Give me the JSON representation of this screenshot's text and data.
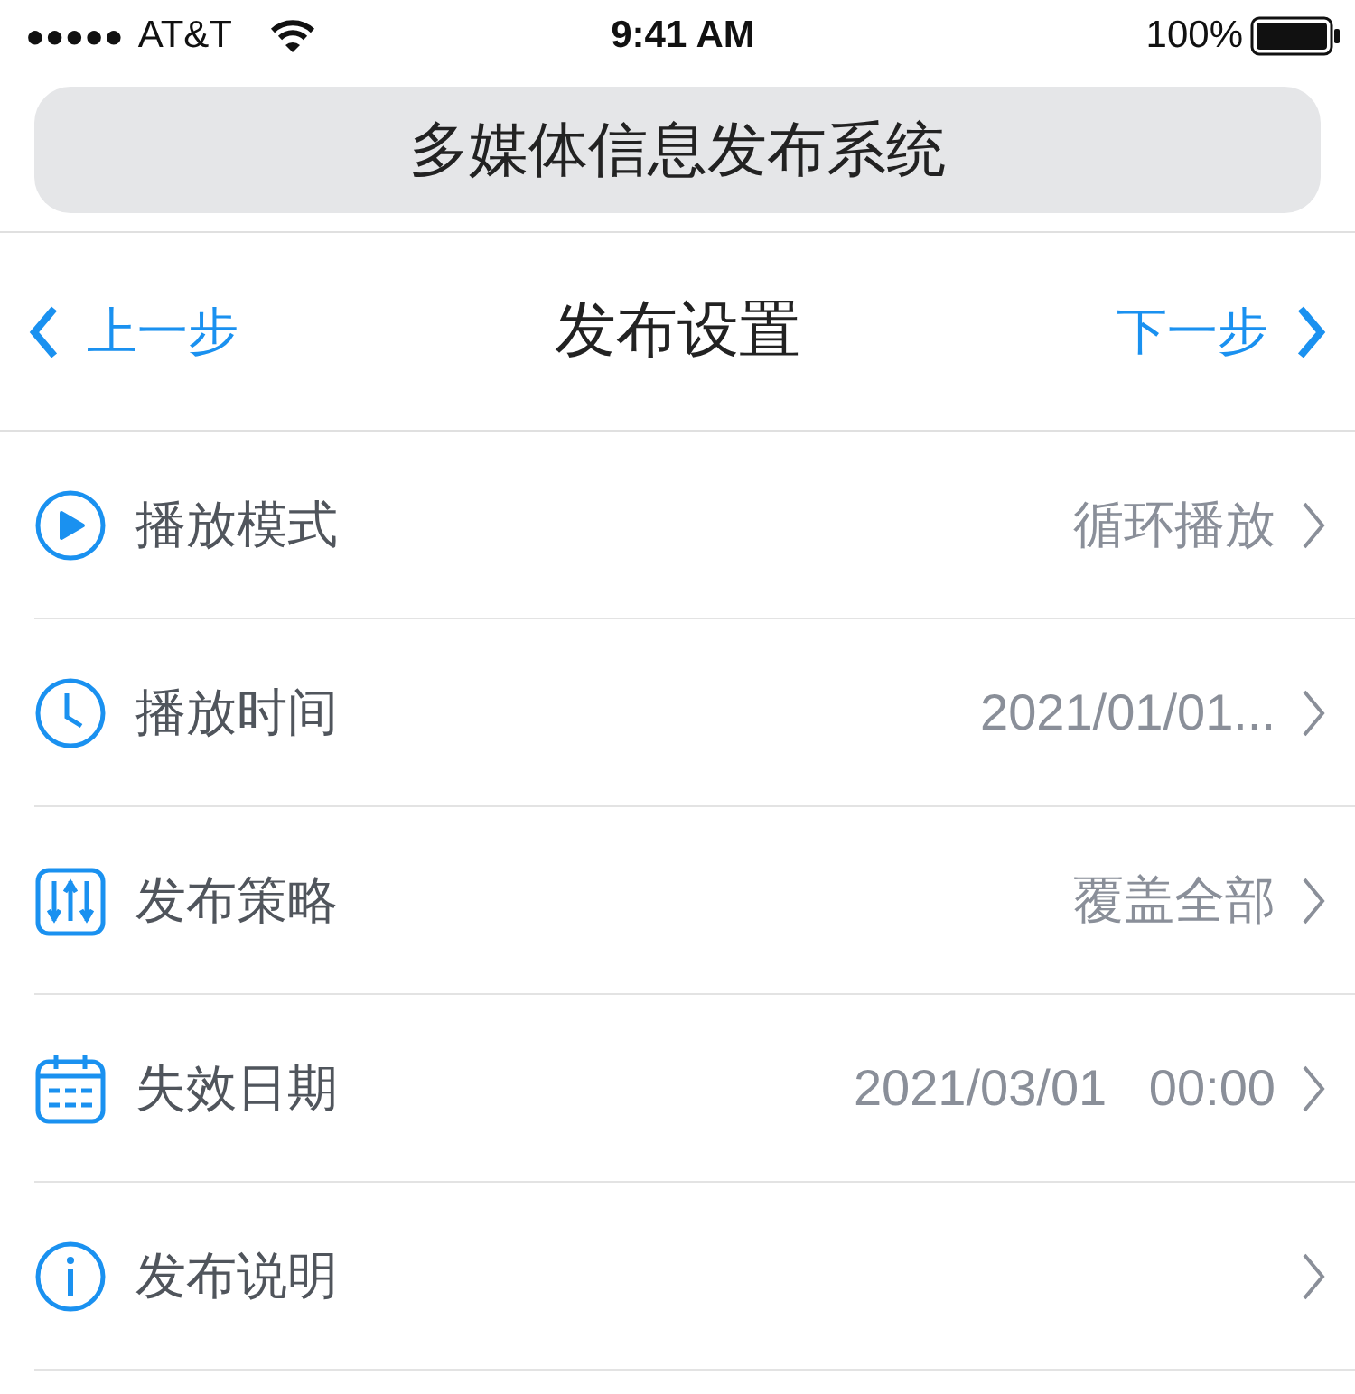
{
  "status_bar": {
    "signal_dots": "●●●●●",
    "carrier": "AT&T",
    "time": "9:41 AM",
    "battery": "100%"
  },
  "app_title": "多媒体信息发布系统",
  "nav": {
    "back": "上一步",
    "title": "发布设置",
    "next": "下一步"
  },
  "rows": [
    {
      "label": "播放模式",
      "value": "循环播放"
    },
    {
      "label": "播放时间",
      "value": "2021/01/01..."
    },
    {
      "label": "发布策略",
      "value": "覆盖全部"
    },
    {
      "label": "失效日期",
      "value": "2021/03/01   00:00"
    },
    {
      "label": "发布说明"
    }
  ]
}
